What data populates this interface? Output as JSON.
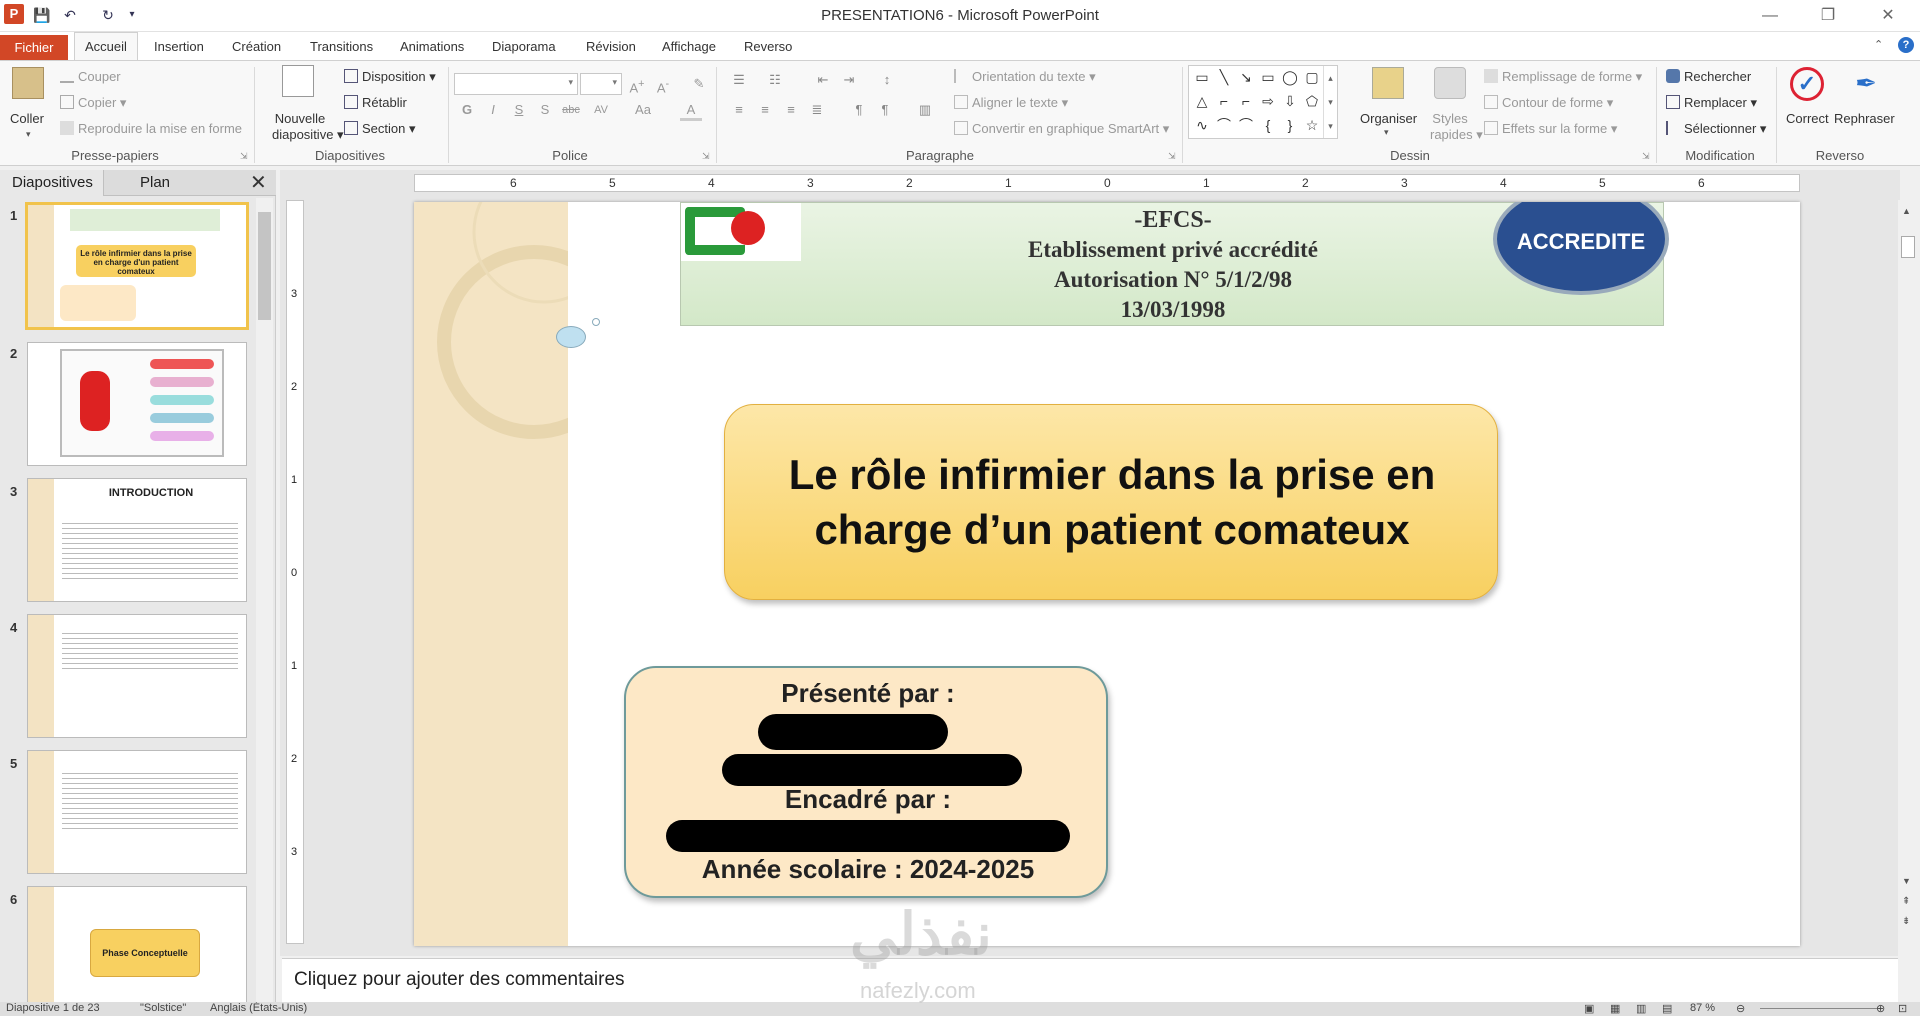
{
  "window": {
    "title": "PRESENTATION6 - Microsoft PowerPoint"
  },
  "tabs": [
    "Fichier",
    "Accueil",
    "Insertion",
    "Création",
    "Transitions",
    "Animations",
    "Diaporama",
    "Révision",
    "Affichage",
    "Reverso"
  ],
  "ribbon": {
    "clipboard": {
      "label": "Presse-papiers",
      "paste": "Coller",
      "cut": "Couper",
      "copy": "Copier",
      "format_painter": "Reproduire la mise en forme"
    },
    "slides": {
      "label": "Diapositives",
      "new_slide_1": "Nouvelle",
      "new_slide_2": "diapositive",
      "layout": "Disposition",
      "reset": "Rétablir",
      "section": "Section"
    },
    "font": {
      "label": "Police"
    },
    "paragraph": {
      "label": "Paragraphe",
      "text_direction": "Orientation du texte",
      "align_text": "Aligner le texte",
      "smartart": "Convertir en graphique SmartArt"
    },
    "drawing": {
      "label": "Dessin",
      "arrange": "Organiser",
      "quick_styles_1": "Styles",
      "quick_styles_2": "rapides",
      "shape_fill": "Remplissage de forme",
      "shape_outline": "Contour de forme",
      "shape_effects": "Effets sur la forme"
    },
    "editing": {
      "label": "Modification",
      "find": "Rechercher",
      "replace": "Remplacer",
      "select": "Sélectionner"
    },
    "reverso": {
      "label": "Reverso",
      "correct": "Correct",
      "rephrase": "Rephraser"
    }
  },
  "pane": {
    "tab_slides": "Diapositives",
    "tab_outline": "Plan"
  },
  "thumbnails": [
    {
      "num": "1",
      "title": "Le rôle infirmier dans la prise en charge d'un patient comateux"
    },
    {
      "num": "2",
      "title": ""
    },
    {
      "num": "3",
      "title": "INTRODUCTION"
    },
    {
      "num": "4",
      "title": ""
    },
    {
      "num": "5",
      "title": ""
    },
    {
      "num": "6",
      "title": "Phase Conceptuelle"
    }
  ],
  "ruler": {
    "h_ticks": [
      "6",
      "5",
      "4",
      "3",
      "2",
      "1",
      "0",
      "1",
      "2",
      "3",
      "4",
      "5",
      "6"
    ],
    "v_ticks": [
      "3",
      "2",
      "1",
      "0",
      "1",
      "2",
      "3"
    ]
  },
  "slide": {
    "header": {
      "line1": "-EFCS-",
      "line2": "Etablissement  privé  accrédité",
      "line3": "Autorisation  N° 5/1/2/98",
      "line4": "13/03/1998",
      "seal": "ACCREDITE"
    },
    "title_line1": "Le rôle infirmier dans la prise en",
    "title_line2": "charge d’un patient comateux",
    "presented_by": "Présenté par :",
    "supervised_by": "Encadré par :",
    "school_year": "Année scolaire : 2024-2025"
  },
  "notes": {
    "placeholder": "Cliquez pour ajouter des commentaires"
  },
  "statusbar": {
    "slide_info": "Diapositive 1 de 23",
    "theme": "\"Solstice\"",
    "language": "Anglais (États-Unis)",
    "zoom": "87 %"
  },
  "watermark": {
    "arabic": "نفذلي",
    "latin": "nafezly.com"
  },
  "colors": {
    "accent": "#d24726",
    "title_fill": "#f8d060",
    "box_fill": "#fde8c6",
    "selection": "#f1c34b"
  }
}
